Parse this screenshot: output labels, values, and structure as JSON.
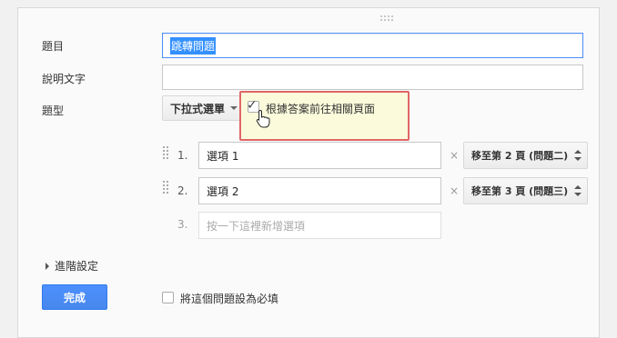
{
  "form": {
    "title_label": "題目",
    "title_value": "跳轉問題",
    "help_label": "說明文字",
    "help_value": "",
    "type_label": "題型",
    "type_value": "下拉式選單",
    "goto_page_checkbox_label": "根據答案前往相關頁面",
    "goto_page_checked": true,
    "options": [
      {
        "number": "1.",
        "value": "選項 1",
        "goto": "移至第 2 頁 (問題二)"
      },
      {
        "number": "2.",
        "value": "選項 2",
        "goto": "移至第 3 頁 (問題三)"
      }
    ],
    "new_option_number": "3.",
    "new_option_placeholder": "按一下這裡新增選項",
    "remove_symbol": "×",
    "advanced_settings": "進階設定",
    "done_button": "完成",
    "required_label": "將這個問題設為必填",
    "required_checked": false
  }
}
